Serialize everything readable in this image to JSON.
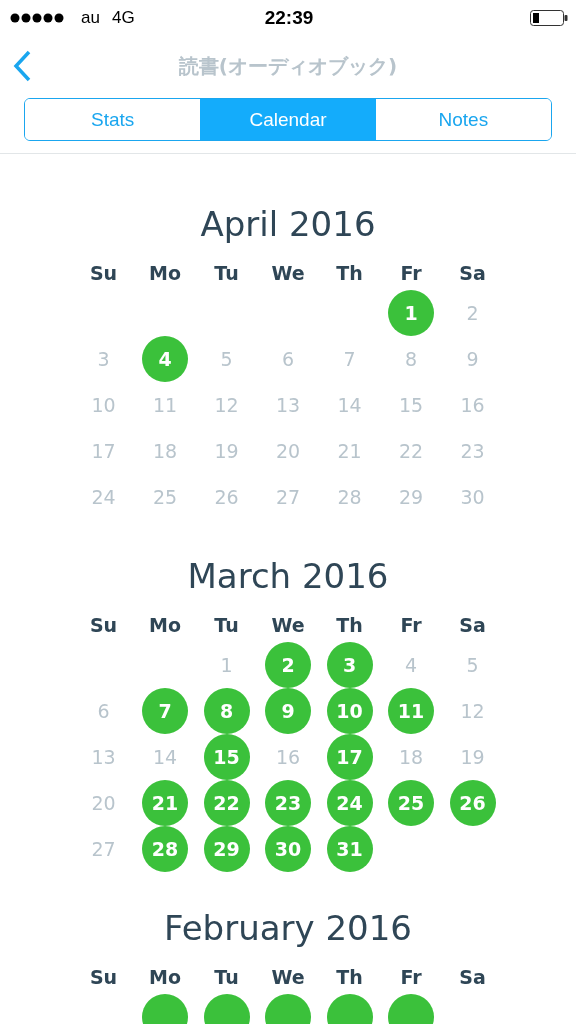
{
  "status_bar": {
    "carrier": "au",
    "network": "4G",
    "time": "22:39"
  },
  "nav": {
    "title": "読書(オーディオブック)"
  },
  "tabs": [
    {
      "label": "Stats",
      "selected": false
    },
    {
      "label": "Calendar",
      "selected": true
    },
    {
      "label": "Notes",
      "selected": false
    }
  ],
  "months": [
    {
      "title": "April 2016",
      "weekdays": [
        "Su",
        "Mo",
        "Tu",
        "We",
        "Th",
        "Fr",
        "Sa"
      ],
      "weeks": [
        [
          {
            "kind": "blank"
          },
          {
            "kind": "blank"
          },
          {
            "kind": "blank"
          },
          {
            "kind": "blank"
          },
          {
            "kind": "blank"
          },
          {
            "kind": "day",
            "label": "1",
            "done": true
          },
          {
            "kind": "day",
            "label": "2",
            "done": false
          }
        ],
        [
          {
            "kind": "day",
            "label": "3",
            "done": false
          },
          {
            "kind": "day",
            "label": "4",
            "done": true
          },
          {
            "kind": "day",
            "label": "5",
            "done": false
          },
          {
            "kind": "day",
            "label": "6",
            "done": false
          },
          {
            "kind": "day",
            "label": "7",
            "done": false
          },
          {
            "kind": "day",
            "label": "8",
            "done": false
          },
          {
            "kind": "day",
            "label": "9",
            "done": false
          }
        ],
        [
          {
            "kind": "day",
            "label": "10",
            "done": false
          },
          {
            "kind": "day",
            "label": "11",
            "done": false
          },
          {
            "kind": "day",
            "label": "12",
            "done": false
          },
          {
            "kind": "day",
            "label": "13",
            "done": false
          },
          {
            "kind": "day",
            "label": "14",
            "done": false
          },
          {
            "kind": "day",
            "label": "15",
            "done": false
          },
          {
            "kind": "day",
            "label": "16",
            "done": false
          }
        ],
        [
          {
            "kind": "day",
            "label": "17",
            "done": false
          },
          {
            "kind": "day",
            "label": "18",
            "done": false
          },
          {
            "kind": "day",
            "label": "19",
            "done": false
          },
          {
            "kind": "day",
            "label": "20",
            "done": false
          },
          {
            "kind": "day",
            "label": "21",
            "done": false
          },
          {
            "kind": "day",
            "label": "22",
            "done": false
          },
          {
            "kind": "day",
            "label": "23",
            "done": false
          }
        ],
        [
          {
            "kind": "day",
            "label": "24",
            "done": false
          },
          {
            "kind": "day",
            "label": "25",
            "done": false
          },
          {
            "kind": "day",
            "label": "26",
            "done": false
          },
          {
            "kind": "day",
            "label": "27",
            "done": false
          },
          {
            "kind": "day",
            "label": "28",
            "done": false
          },
          {
            "kind": "day",
            "label": "29",
            "done": false
          },
          {
            "kind": "day",
            "label": "30",
            "done": false
          }
        ]
      ]
    },
    {
      "title": "March 2016",
      "weekdays": [
        "Su",
        "Mo",
        "Tu",
        "We",
        "Th",
        "Fr",
        "Sa"
      ],
      "weeks": [
        [
          {
            "kind": "blank"
          },
          {
            "kind": "blank"
          },
          {
            "kind": "day",
            "label": "1",
            "done": false
          },
          {
            "kind": "day",
            "label": "2",
            "done": true
          },
          {
            "kind": "day",
            "label": "3",
            "done": true
          },
          {
            "kind": "day",
            "label": "4",
            "done": false
          },
          {
            "kind": "day",
            "label": "5",
            "done": false
          }
        ],
        [
          {
            "kind": "day",
            "label": "6",
            "done": false
          },
          {
            "kind": "day",
            "label": "7",
            "done": true
          },
          {
            "kind": "day",
            "label": "8",
            "done": true
          },
          {
            "kind": "day",
            "label": "9",
            "done": true
          },
          {
            "kind": "day",
            "label": "10",
            "done": true
          },
          {
            "kind": "day",
            "label": "11",
            "done": true
          },
          {
            "kind": "day",
            "label": "12",
            "done": false
          }
        ],
        [
          {
            "kind": "day",
            "label": "13",
            "done": false
          },
          {
            "kind": "day",
            "label": "14",
            "done": false
          },
          {
            "kind": "day",
            "label": "15",
            "done": true
          },
          {
            "kind": "day",
            "label": "16",
            "done": false
          },
          {
            "kind": "day",
            "label": "17",
            "done": true
          },
          {
            "kind": "day",
            "label": "18",
            "done": false
          },
          {
            "kind": "day",
            "label": "19",
            "done": false
          }
        ],
        [
          {
            "kind": "day",
            "label": "20",
            "done": false
          },
          {
            "kind": "day",
            "label": "21",
            "done": true
          },
          {
            "kind": "day",
            "label": "22",
            "done": true
          },
          {
            "kind": "day",
            "label": "23",
            "done": true
          },
          {
            "kind": "day",
            "label": "24",
            "done": true
          },
          {
            "kind": "day",
            "label": "25",
            "done": true
          },
          {
            "kind": "day",
            "label": "26",
            "done": true
          }
        ],
        [
          {
            "kind": "day",
            "label": "27",
            "done": false
          },
          {
            "kind": "day",
            "label": "28",
            "done": true
          },
          {
            "kind": "day",
            "label": "29",
            "done": true
          },
          {
            "kind": "day",
            "label": "30",
            "done": true
          },
          {
            "kind": "day",
            "label": "31",
            "done": true
          },
          {
            "kind": "blank"
          },
          {
            "kind": "blank"
          }
        ]
      ]
    },
    {
      "title": "February 2016",
      "weekdays": [
        "Su",
        "Mo",
        "Tu",
        "We",
        "Th",
        "Fr",
        "Sa"
      ],
      "weeks": [
        [
          {
            "kind": "blank"
          },
          {
            "kind": "cut",
            "done": true
          },
          {
            "kind": "cut",
            "done": true
          },
          {
            "kind": "cut",
            "done": true
          },
          {
            "kind": "cut",
            "done": true
          },
          {
            "kind": "cut",
            "done": true
          },
          {
            "kind": "blank"
          }
        ]
      ]
    }
  ]
}
